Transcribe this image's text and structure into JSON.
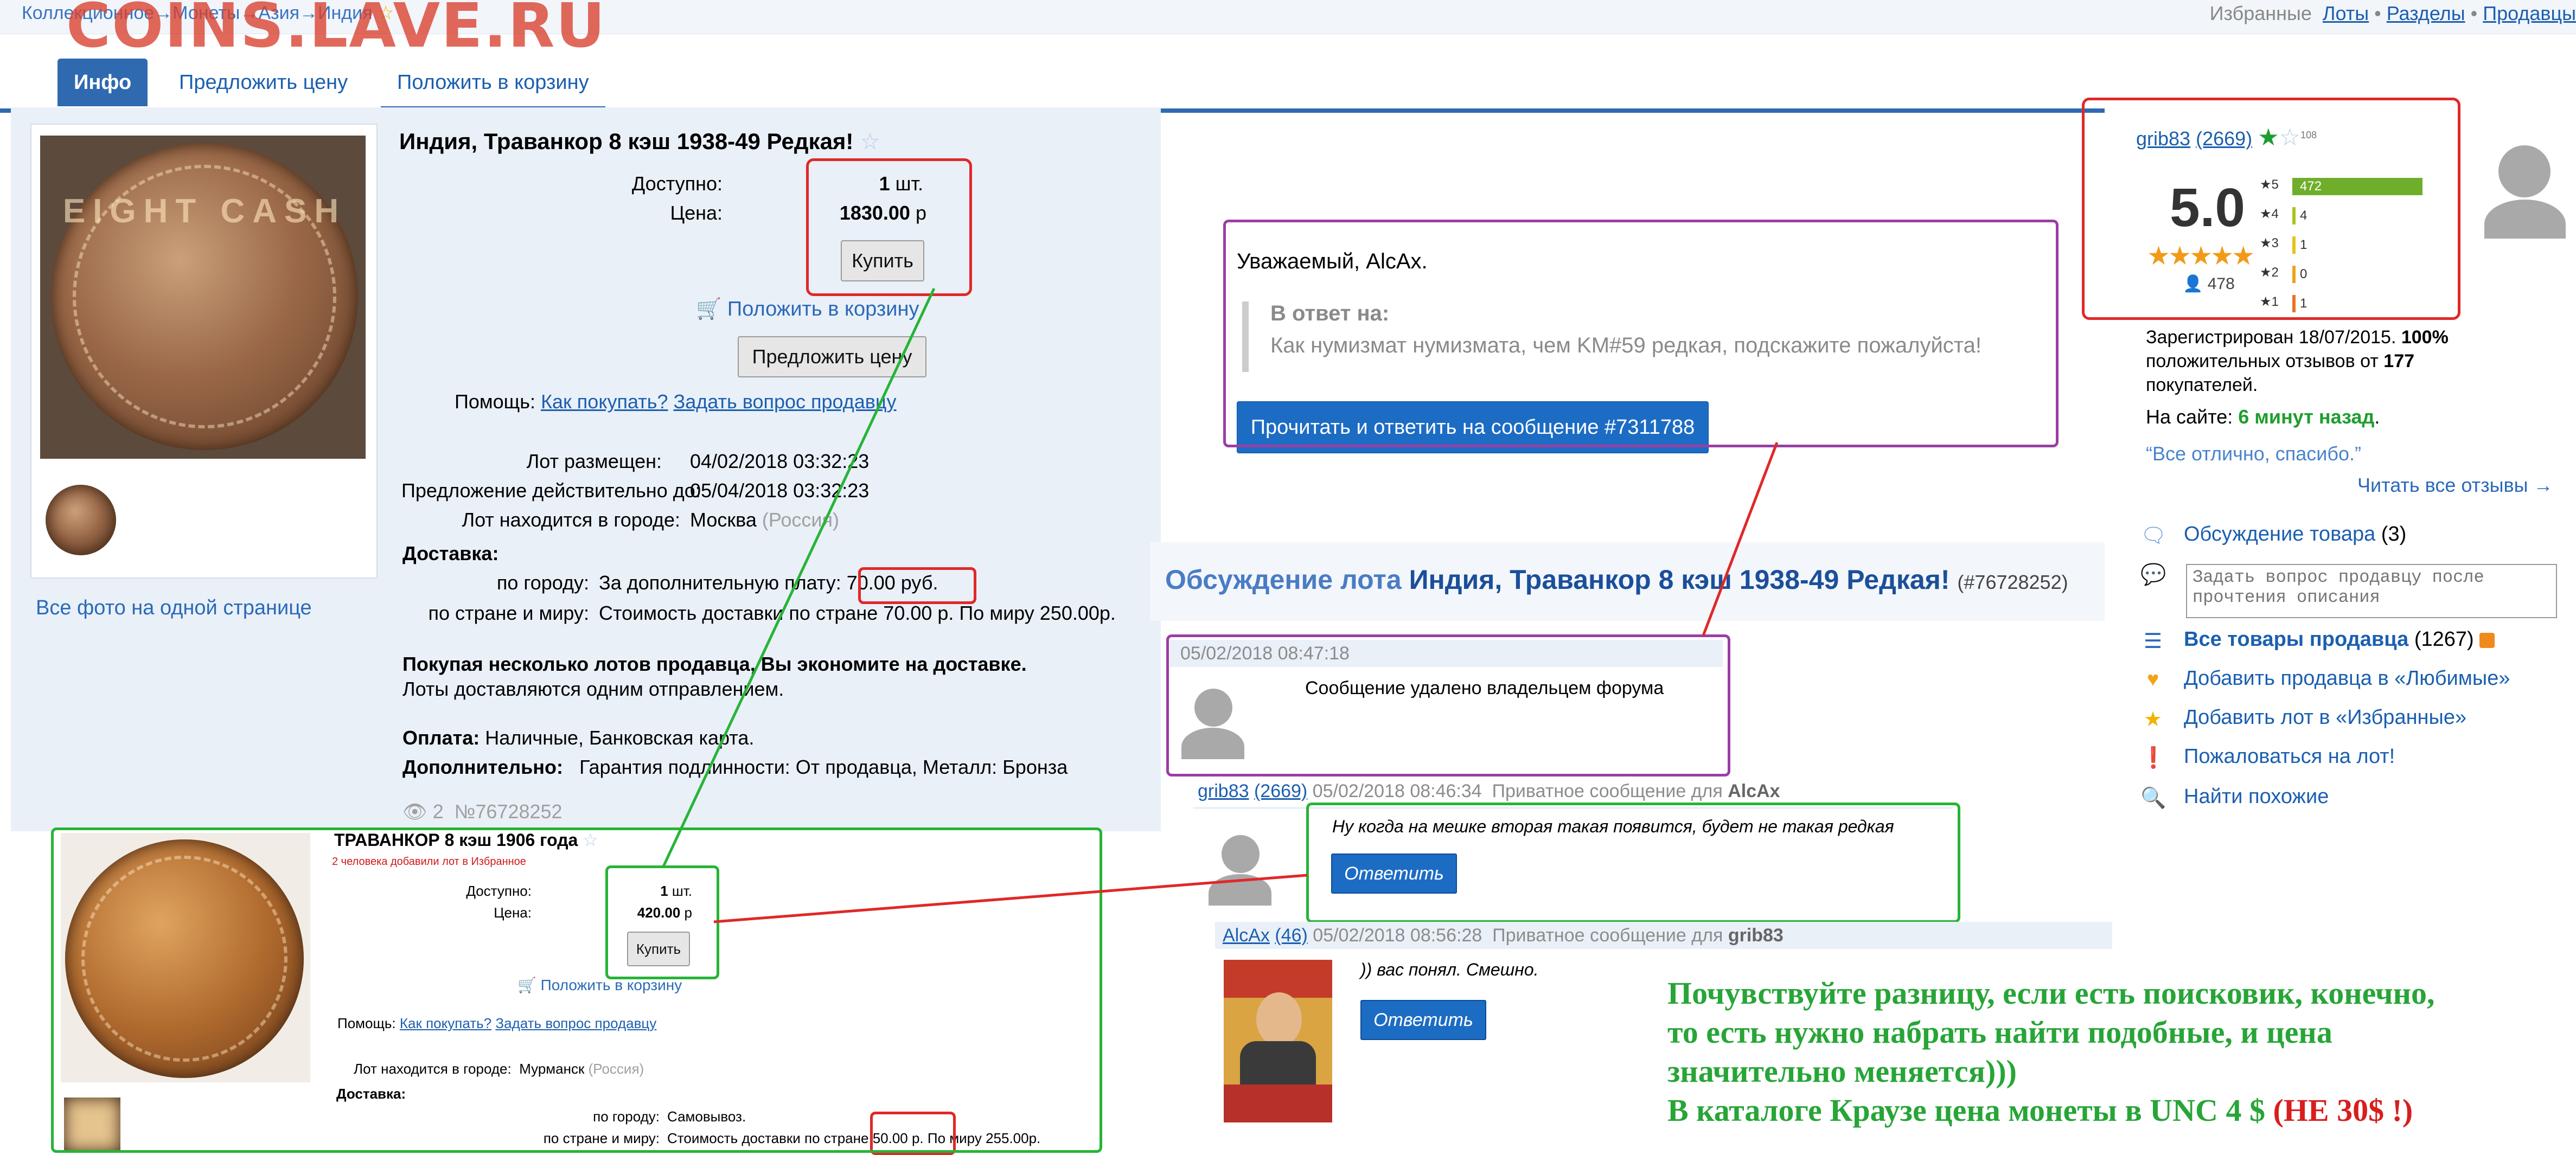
{
  "watermark": "COINS.LAVE.RU",
  "breadcrumb": "Коллекционное→Монеты→Азия→Индия",
  "topright": {
    "favorites": "Избранные",
    "lots": "Лоты",
    "sep1": " • ",
    "sections": "Разделы",
    "sep2": " • ",
    "sales": "Продавцы"
  },
  "tabs": {
    "info": "Инфо",
    "offer": "Предложить цену",
    "cart": "Положить в корзину"
  },
  "lot": {
    "title": "Индия, Траванкор 8 кэш 1938-49 Редкая!",
    "avail_label": "Доступно:",
    "avail_qty": "1",
    "avail_unit": "шт.",
    "price_label": "Цена:",
    "price": "1830.00",
    "price_cur": "р",
    "buy": "Купить",
    "add_cart": "Положить в корзину",
    "offer": "Предложить цену",
    "help_label": "Помощь:",
    "help_how": "Как покупать?",
    "help_ask": "Задать вопрос продавцу",
    "placed_label": "Лот размещен:",
    "placed": "04/02/2018 03:32:23",
    "valid_label": "Предложение действительно до:",
    "valid": "05/04/2018 03:32:23",
    "city_label": "Лот находится в городе:",
    "city": "Москва",
    "country": "(Россия)",
    "delivery": "Доставка:",
    "city_del_label": "по городу:",
    "city_del": "За дополнительную плату:",
    "city_del_price": "70.00 руб.",
    "world_del_label": "по стране и миру:",
    "world_del": "Стоимость доставки по стране 70.00 р. По миру 250.00р.",
    "save_bold": "Покупая несколько лотов продавца, Вы экономите на доставке.",
    "save_note": "Лоты доставляются одним отправлением.",
    "pay_label": "Оплата:",
    "pay": "Наличные, Банковская карта.",
    "extra_label": "Дополнительно:",
    "extra": "Гарантия подлинности: От продавца, Металл: Бронза",
    "views": "2",
    "lot_no": "№76728252",
    "all_photos": "Все фото на одной странице",
    "coin_text": "EIGHT CASH"
  },
  "message": {
    "greeting": "Уважаемый, AlcAx.",
    "reply_label": "В ответ на:",
    "reply_text": "Как нумизмат нумизмата, чем KM#59 редкая, подскажите пожалуйста!",
    "button": "Прочитать и ответить на сообщение #7311788"
  },
  "discussion": {
    "title_prefix": "Обсуждение лота",
    "title_lot": "Индия, Траванкор 8 кэш 1938-49 Редкая!",
    "lot_no": "(#76728252)",
    "posts": [
      {
        "date": "05/02/2018 08:47:18",
        "text": "Сообщение удалено владельцем форума"
      },
      {
        "user": "grib83",
        "rating": "(2669)",
        "date": "05/02/2018 08:46:34",
        "note": "Приватное сообщение для",
        "to": "AlcAx",
        "text": "Ну когда на мешке вторая такая появится, будет не такая редкая",
        "button": "Ответить"
      },
      {
        "user": "AlcAx",
        "rating": "(46)",
        "date": "05/02/2018 08:56:28",
        "note": "Приватное сообщение для",
        "to": "grib83",
        "text": ")) вас понял. Смешно.",
        "button": "Ответить"
      }
    ]
  },
  "seller": {
    "name": "grib83",
    "rating": "(2669)",
    "badge": "108",
    "score": "5.0",
    "reviews": "478",
    "bars": [
      {
        "label": "★5",
        "count": "472",
        "frac": 1.0,
        "color": "#6fae2a"
      },
      {
        "label": "★4",
        "count": "4",
        "frac": 0.02,
        "color": "#a6c51f"
      },
      {
        "label": "★3",
        "count": "1",
        "frac": 0.01,
        "color": "#e3c516"
      },
      {
        "label": "★2",
        "count": "0",
        "frac": 0.005,
        "color": "#f0a21a"
      },
      {
        "label": "★1",
        "count": "1",
        "frac": 0.01,
        "color": "#e87424"
      }
    ],
    "registered_label": "Зарегистрирован",
    "registered": "18/07/2015.",
    "positive": "100%",
    "positive_text": "положительных отзывов от",
    "positive_count": "177",
    "buyers": "покупателей.",
    "online_label": "На сайте:",
    "online": "6 минут назад",
    "quote": "“Все отлично, спасибо.”",
    "all_reviews": "Читать все отзывы →",
    "discuss": "Обсуждение товара",
    "discuss_count": "(3)",
    "ask_placeholder": "Задать вопрос продавцу после прочтения описания",
    "all_goods": "Все товары продавца",
    "goods_count": "(1267)",
    "fav_seller": "Добавить продавца в «Любимые»",
    "fav_lot": "Добавить лот в «Избранные»",
    "complain": "Пожаловаться на лот!",
    "similar": "Найти похожие"
  },
  "lot2": {
    "title": "ТРАВАНКОР 8 кэш 1906 года",
    "added": "2 человека добавили лот в Избранное",
    "avail_label": "Доступно:",
    "avail": "1",
    "avail_unit": "шт.",
    "price_label": "Цена:",
    "price": "420.00",
    "price_cur": "р",
    "buy": "Купить",
    "add_cart": "Положить в корзину",
    "help_label": "Помощь:",
    "help_how": "Как покупать?",
    "help_ask": "Задать вопрос продавцу",
    "city_label": "Лот находится в городе:",
    "city": "Мурманск",
    "country": "(Россия)",
    "delivery": "Доставка:",
    "city_del_label": "по городу:",
    "city_del": "Самовывоз.",
    "world_del_label": "по стране и миру:",
    "world_del_a": "Стоимость доставки по стране",
    "world_del_price": "50.00 р.",
    "world_del_b": "По миру 255.00р."
  },
  "annotation": {
    "line1": "Почувствуйте разницу, если есть поисковик, конечно,",
    "line2": "то есть нужно набрать найти подобные, и цена",
    "line3": "значительно меняется)))",
    "line4a": "В каталоге Краузе цена монеты в UNC 4 $",
    "line4b": "(НЕ 30$ !)"
  },
  "colors": {
    "accent": "#2f6ab0",
    "red_mark": "#e02828",
    "green_mark": "#27b437",
    "purple_mark": "#9a3fa4"
  }
}
